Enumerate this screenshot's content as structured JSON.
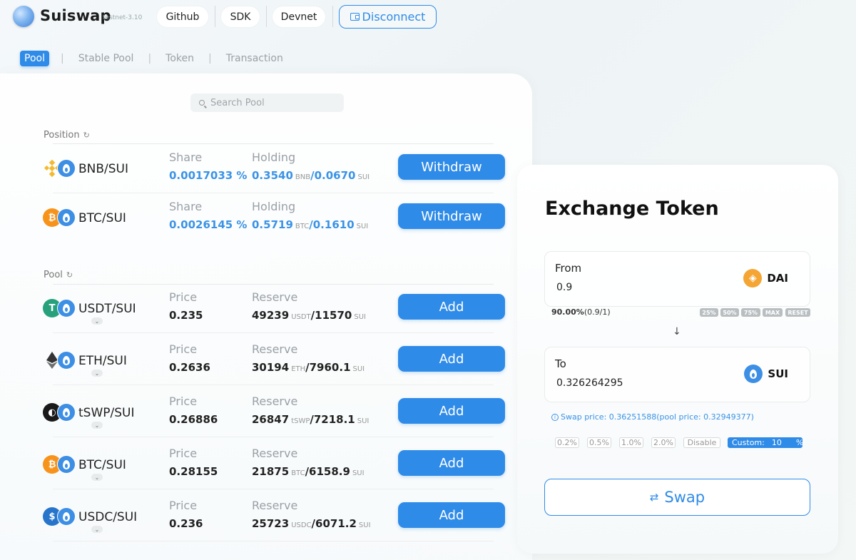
{
  "header": {
    "brand": "Suiswap",
    "version": "testnet-3.10",
    "links": [
      "Github",
      "SDK",
      "Devnet"
    ],
    "disconnect_label": "Disconnect"
  },
  "tabs": [
    "Pool",
    "Stable Pool",
    "Token",
    "Transaction"
  ],
  "search": {
    "placeholder": "Search Pool"
  },
  "position": {
    "title": "Position",
    "rows": [
      {
        "pair": "BNB/SUI",
        "share_label": "Share",
        "share": "0.0017033 %",
        "holding_label": "Holding",
        "holding_a": "0.3540",
        "unit_a": "BNB",
        "holding_b": "/0.0670",
        "unit_b": "SUI",
        "action": "Withdraw"
      },
      {
        "pair": "BTC/SUI",
        "share_label": "Share",
        "share": "0.0026145 %",
        "holding_label": "Holding",
        "holding_a": "0.5719",
        "unit_a": "BTC",
        "holding_b": "/0.1610",
        "unit_b": "SUI",
        "action": "Withdraw"
      }
    ]
  },
  "pool": {
    "title": "Pool",
    "rows": [
      {
        "pair": "USDT/SUI",
        "price_label": "Price",
        "price": "0.235",
        "reserve_label": "Reserve",
        "reserve_a": "49239",
        "unit_a": "USDT",
        "reserve_b": "/11570",
        "unit_b": "SUI",
        "action": "Add"
      },
      {
        "pair": "ETH/SUI",
        "price_label": "Price",
        "price": "0.2636",
        "reserve_label": "Reserve",
        "reserve_a": "30194",
        "unit_a": "ETH",
        "reserve_b": "/7960.1",
        "unit_b": "SUI",
        "action": "Add"
      },
      {
        "pair": "tSWP/SUI",
        "price_label": "Price",
        "price": "0.26886",
        "reserve_label": "Reserve",
        "reserve_a": "26847",
        "unit_a": "tSWP",
        "reserve_b": "/7218.1",
        "unit_b": "SUI",
        "action": "Add"
      },
      {
        "pair": "BTC/SUI",
        "price_label": "Price",
        "price": "0.28155",
        "reserve_label": "Reserve",
        "reserve_a": "21875",
        "unit_a": "BTC",
        "reserve_b": "/6158.9",
        "unit_b": "SUI",
        "action": "Add"
      },
      {
        "pair": "USDC/SUI",
        "price_label": "Price",
        "price": "0.236",
        "reserve_label": "Reserve",
        "reserve_a": "25723",
        "unit_a": "USDC",
        "reserve_b": "/6071.2",
        "unit_b": "SUI",
        "action": "Add"
      }
    ]
  },
  "exchange": {
    "title": "Exchange Token",
    "from_label": "From",
    "from_value": "0.9",
    "from_token": "DAI",
    "percent": "90.00%",
    "percent_detail": "(0.9/1)",
    "quick": [
      "25%",
      "50%",
      "75%",
      "MAX",
      "RESET"
    ],
    "to_label": "To",
    "to_value": "0.326264295",
    "to_token": "SUI",
    "swap_price": "Swap price: 0.36251588(pool price: 0.32949377)",
    "slippage": [
      "0.2%",
      "0.5%",
      "1.0%",
      "2.0%",
      "Disable"
    ],
    "custom_label": "Custom:",
    "custom_value": "10",
    "custom_unit": "%",
    "swap_label": "Swap"
  },
  "colors": {
    "accent": "#2f8be8",
    "bnb": "#f3ba2f",
    "btc": "#f7931a",
    "usdt": "#26a17b",
    "sui": "#3d8fe5",
    "dai": "#f4a533"
  },
  "icons": [
    "wallet-icon",
    "search-icon",
    "refresh-icon",
    "sui-drop-icon",
    "bnb-icon",
    "btc-icon",
    "usdt-icon",
    "eth-icon",
    "tswp-icon",
    "usdc-icon",
    "dai-icon",
    "info-icon",
    "arrow-down-icon",
    "swap-arrows-icon"
  ]
}
